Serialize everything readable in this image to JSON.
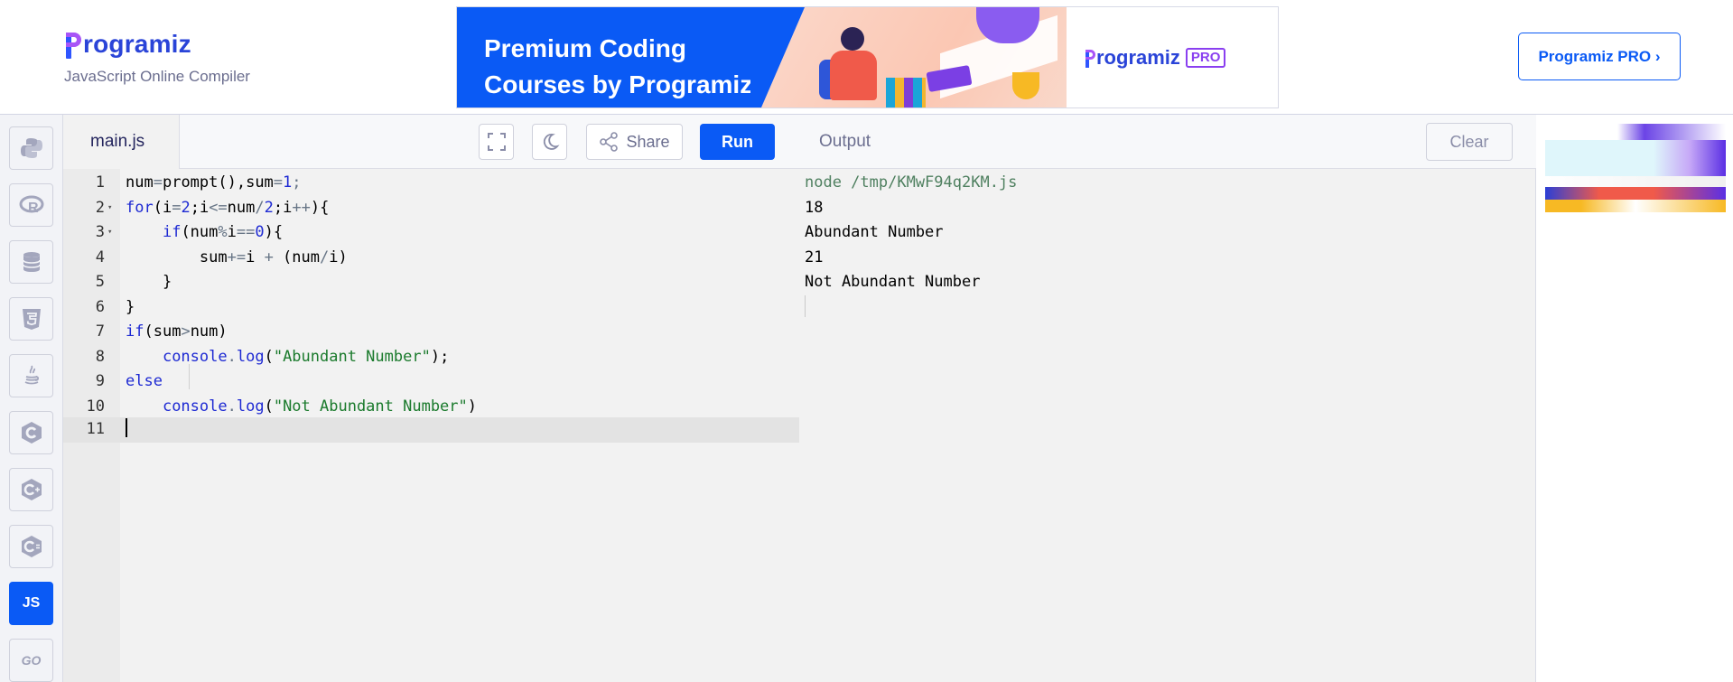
{
  "header": {
    "logo_text": "rogramiz",
    "subtitle": "JavaScript Online Compiler",
    "banner": {
      "line1": "Premium Coding",
      "line2": "Courses by Programiz",
      "pro_logo_text": "rogramiz",
      "pro_badge": "PRO"
    },
    "pro_button": "Programiz PRO ›"
  },
  "sidebar": {
    "languages": [
      {
        "name": "python",
        "icon": "python-icon"
      },
      {
        "name": "r",
        "icon": "r-icon"
      },
      {
        "name": "sql",
        "icon": "database-icon"
      },
      {
        "name": "html",
        "icon": "html5-icon"
      },
      {
        "name": "java",
        "icon": "java-icon"
      },
      {
        "name": "c",
        "icon": "c-icon"
      },
      {
        "name": "cpp",
        "icon": "cpp-icon"
      },
      {
        "name": "csharp",
        "icon": "csharp-icon"
      },
      {
        "name": "js",
        "label": "JS",
        "active": true
      },
      {
        "name": "go",
        "label": "GO"
      }
    ]
  },
  "editor": {
    "tab": "main.js",
    "share_label": "Share",
    "run_label": "Run",
    "line_numbers": [
      "1",
      "2",
      "3",
      "4",
      "5",
      "6",
      "7",
      "8",
      "9",
      "10",
      "11"
    ],
    "current_line": "11"
  },
  "output": {
    "title": "Output",
    "clear_label": "Clear",
    "lines": [
      "node /tmp/KMwF94q2KM.js",
      "18",
      "Abundant Number",
      "21",
      "Not Abundant Number"
    ]
  },
  "colors": {
    "accent": "#0a5af5",
    "keyword": "#1e2ad3",
    "string": "#1a7a2c"
  }
}
